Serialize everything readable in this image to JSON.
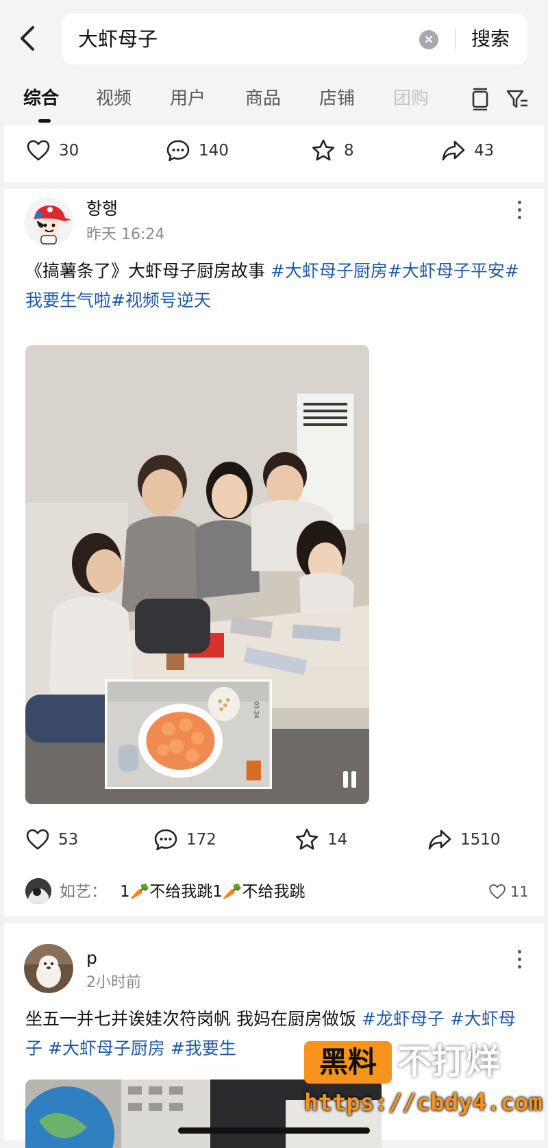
{
  "search": {
    "query": "大虾母子",
    "button_label": "搜索"
  },
  "tabs": [
    "综合",
    "视频",
    "用户",
    "商品",
    "店铺",
    "团购"
  ],
  "colors": {
    "hashtag": "#1f5aa8",
    "watermark_orange": "#f7941d"
  },
  "post0": {
    "likes": "30",
    "comments": "140",
    "favorites": "8",
    "shares": "43"
  },
  "post1": {
    "username": "항행",
    "time": "昨天 16:24",
    "text_plain": "《搞薯条了》大虾母子厨房故事 ",
    "hashtags": [
      "#大虾母子厨房",
      "#大虾母子平安",
      "#我要生气啦",
      "#视频号逆天"
    ],
    "pip_timestamp": "03:24",
    "likes": "53",
    "comments": "172",
    "favorites": "14",
    "shares": "1510",
    "top_comment": {
      "author": "如艺：",
      "text": "1🥕不给我跳1🥕不给我跳",
      "likes": "11"
    }
  },
  "post2": {
    "username": "p",
    "time": "2小时前",
    "text_plain": "坐五一并七并诶娃次符岗帆  我妈在厨房做饭 ",
    "hashtags": [
      "#龙虾母子",
      "#大虾母子",
      "#大虾母子厨房",
      "#我要生"
    ]
  },
  "watermark": {
    "logo": "黑料",
    "text": "不打烊",
    "url": "https://cbdy4.com"
  }
}
